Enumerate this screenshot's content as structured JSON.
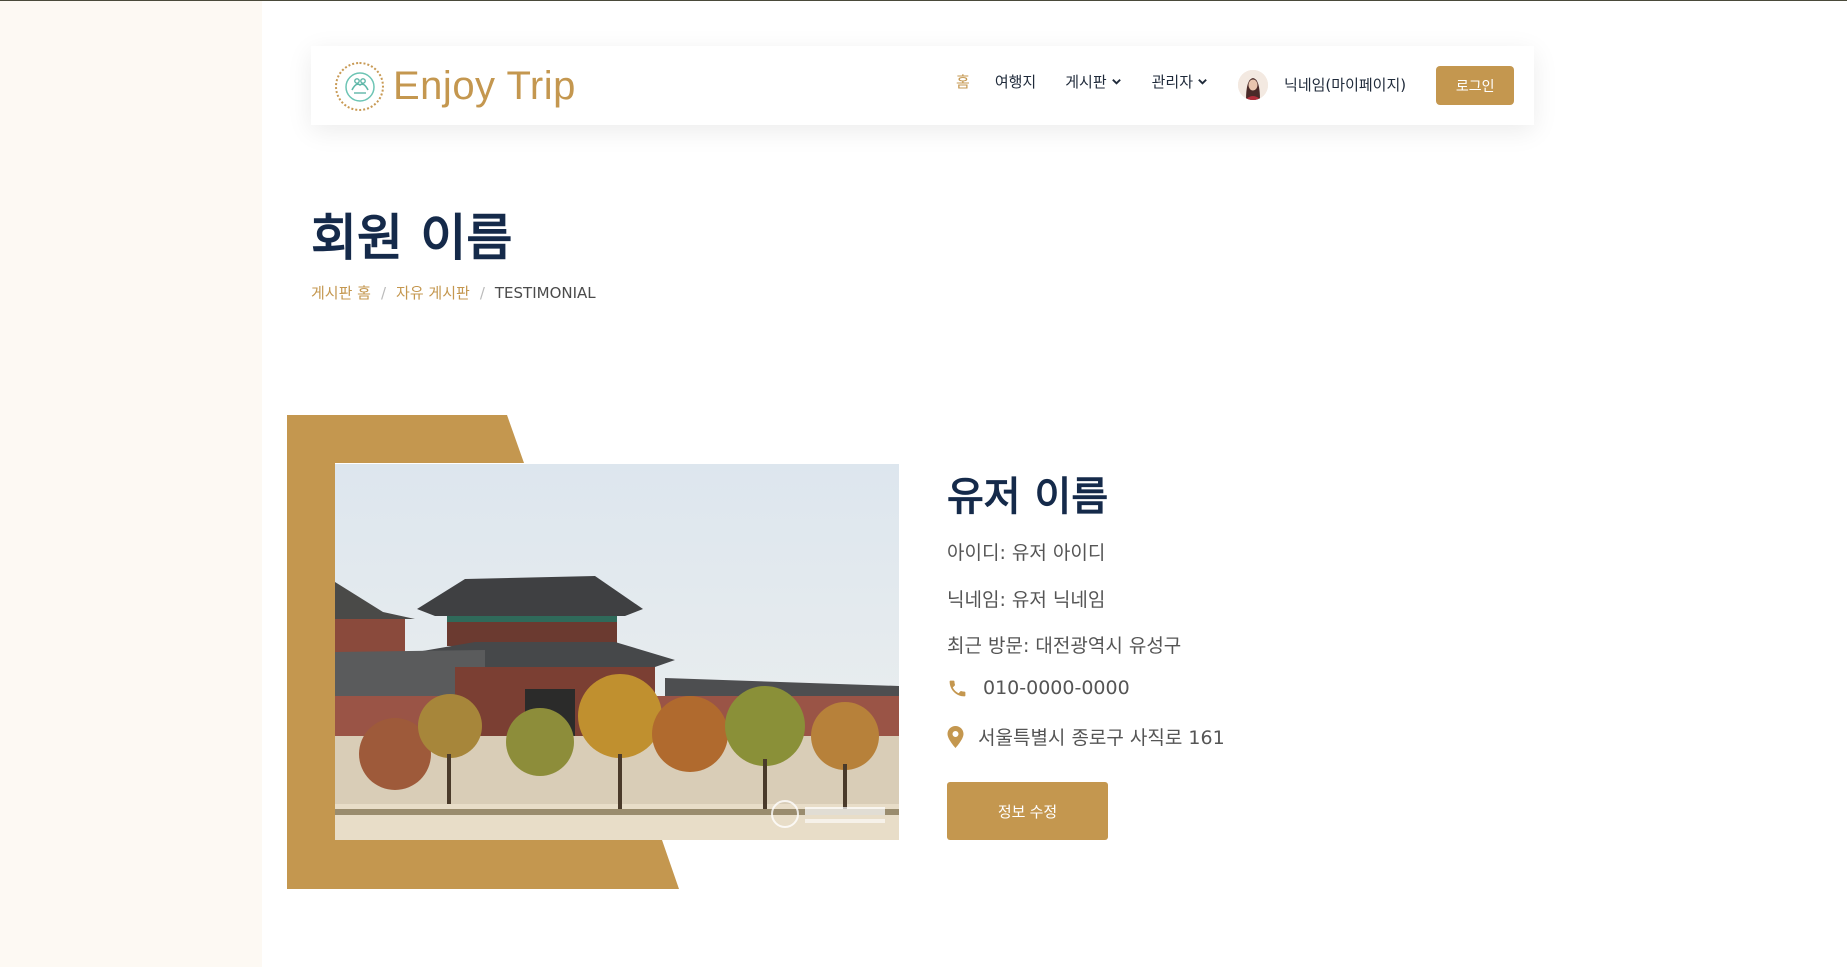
{
  "brand": {
    "name": "Enjoy Trip"
  },
  "nav": {
    "home": "홈",
    "places": "여행지",
    "board": "게시판",
    "admin": "관리자",
    "profile_name": "닉네임(마이페이지)",
    "login": "로그인"
  },
  "page": {
    "title": "회원 이름"
  },
  "breadcrumb": {
    "items": [
      "게시판 홈",
      "자유 게시판"
    ],
    "current": "TESTIMONIAL"
  },
  "profile": {
    "name": "유저 이름",
    "id_line": "아이디: 유저 아이디",
    "nickname_line": "닉네임: 유저 닉네임",
    "recent_line": "최근 방문: 대전광역시 유성구",
    "phone": "010-0000-0000",
    "address": "서울특별시 종로구 사직로 161",
    "edit_button": "정보 수정"
  },
  "colors": {
    "accent": "#c4974f",
    "heading": "#152a4a"
  },
  "icons": [
    "logo-icon",
    "chevron-down-icon",
    "phone-icon",
    "map-pin-icon"
  ]
}
